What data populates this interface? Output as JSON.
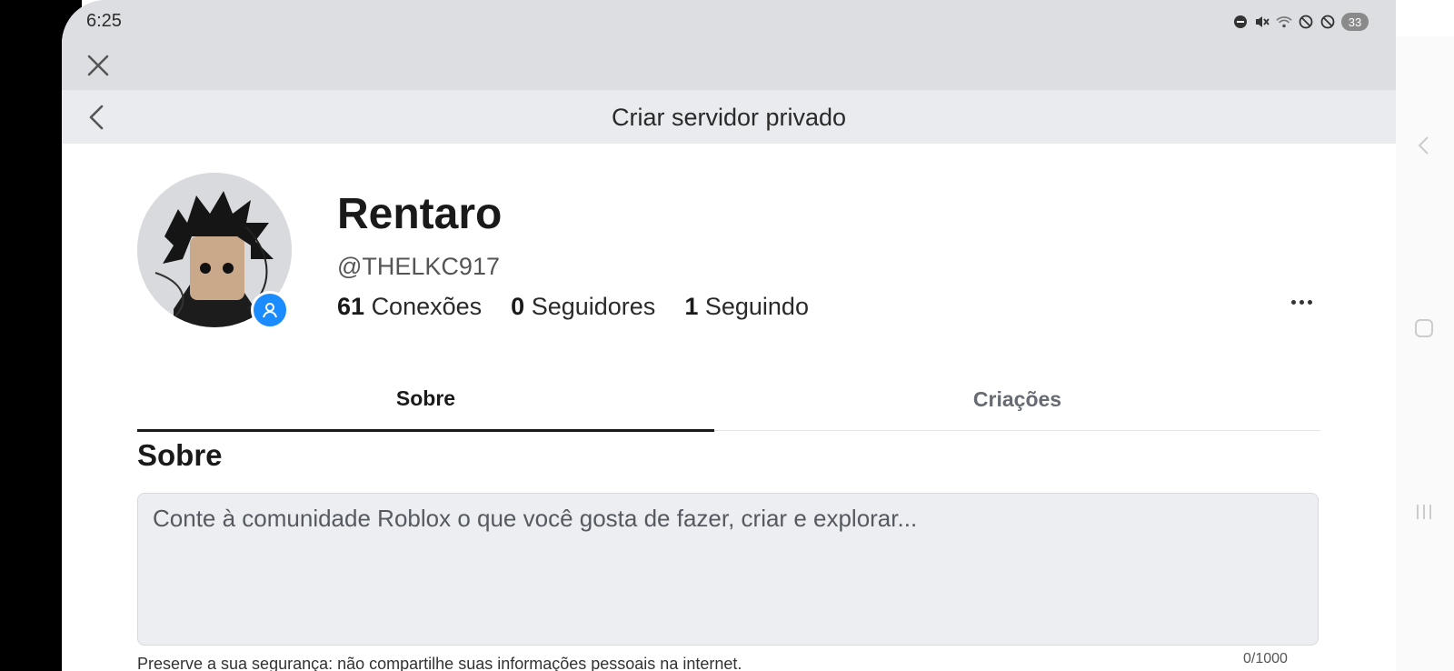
{
  "status_bar": {
    "time": "6:25",
    "battery": "33",
    "icons": [
      "dnd-icon",
      "mute-icon",
      "wifi-icon",
      "blocked-icon",
      "blocked-icon"
    ]
  },
  "header": {
    "title": "Criar servidor privado"
  },
  "profile": {
    "display_name": "Rentaro",
    "username": "@THELKC917",
    "stats": [
      {
        "value": "61",
        "label": "Conexões"
      },
      {
        "value": "0",
        "label": "Seguidores"
      },
      {
        "value": "1",
        "label": "Seguindo"
      }
    ]
  },
  "tabs": [
    {
      "label": "Sobre",
      "active": true
    },
    {
      "label": "Criações",
      "active": false
    }
  ],
  "about": {
    "section_title": "Sobre",
    "placeholder": "Conte à comunidade Roblox o que você gosta de fazer, criar e explorar...",
    "char_count": "0/1000",
    "hint": "Preserve a sua segurança: não compartilhe suas informações pessoais na internet."
  },
  "colors": {
    "accent": "#1a8cff",
    "header_bg": "#e9ebee",
    "status_bg": "#dcdee2"
  }
}
